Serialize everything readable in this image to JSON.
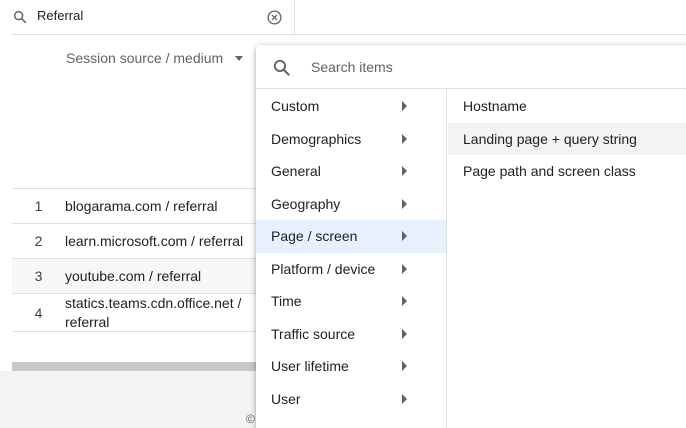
{
  "table_search": {
    "value": "Referral"
  },
  "dimension_header": {
    "label": "Session source / medium"
  },
  "rows": [
    {
      "index": "1",
      "value": "blogarama.com / referral"
    },
    {
      "index": "2",
      "value": "learn.microsoft.com / referral"
    },
    {
      "index": "3",
      "value": "youtube.com / referral"
    },
    {
      "index": "4",
      "value": "statics.teams.cdn.office.net / referral"
    }
  ],
  "footer": {
    "copyright": "©"
  },
  "menu": {
    "search_placeholder": "Search items",
    "categories": [
      {
        "label": "Custom"
      },
      {
        "label": "Demographics"
      },
      {
        "label": "General"
      },
      {
        "label": "Geography"
      },
      {
        "label": "Page / screen",
        "active": true
      },
      {
        "label": "Platform / device"
      },
      {
        "label": "Time"
      },
      {
        "label": "Traffic source"
      },
      {
        "label": "User lifetime"
      },
      {
        "label": "User"
      }
    ],
    "items": [
      {
        "label": "Hostname"
      },
      {
        "label": "Landing page + query string",
        "hovered": true
      },
      {
        "label": "Page path and screen class"
      }
    ]
  },
  "colors": {
    "active_bg": "#e8f0fe",
    "hover_bg": "#f1f3f4",
    "text": "#202124",
    "muted": "#5f6368"
  }
}
